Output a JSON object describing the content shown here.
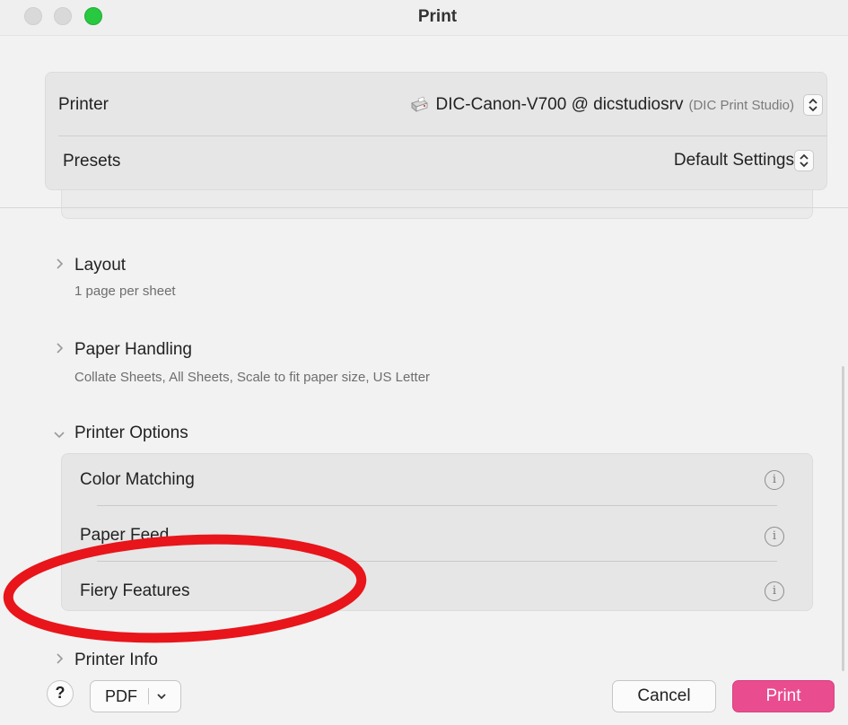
{
  "window": {
    "title": "Print"
  },
  "printer": {
    "label": "Printer",
    "name": "DIC-Canon-V700 @ dicstudiosrv",
    "location": "(DIC Print Studio)",
    "icon": "printer-icon"
  },
  "presets": {
    "label": "Presets",
    "value": "Default Settings"
  },
  "sections": {
    "layout": {
      "title": "Layout",
      "summary": "1 page per sheet",
      "expanded": false
    },
    "paper_handling": {
      "title": "Paper Handling",
      "summary": "Collate Sheets, All Sheets, Scale to fit paper size, US Letter",
      "expanded": false
    },
    "printer_options": {
      "title": "Printer Options",
      "expanded": true,
      "items": [
        {
          "label": "Color Matching",
          "icon": "info-icon"
        },
        {
          "label": "Paper Feed",
          "icon": "info-icon"
        },
        {
          "label": "Fiery Features",
          "icon": "info-icon"
        }
      ]
    },
    "printer_info": {
      "title": "Printer Info",
      "expanded": false
    }
  },
  "annotation": {
    "shape": "ellipse",
    "color": "#e8151b",
    "target": "Fiery Features"
  },
  "footer": {
    "help_label": "?",
    "pdf_label": "PDF",
    "cancel_label": "Cancel",
    "print_label": "Print"
  },
  "colors": {
    "accent": "#e94c8f",
    "zoom_button": "#28c840",
    "annotation": "#e8151b"
  }
}
